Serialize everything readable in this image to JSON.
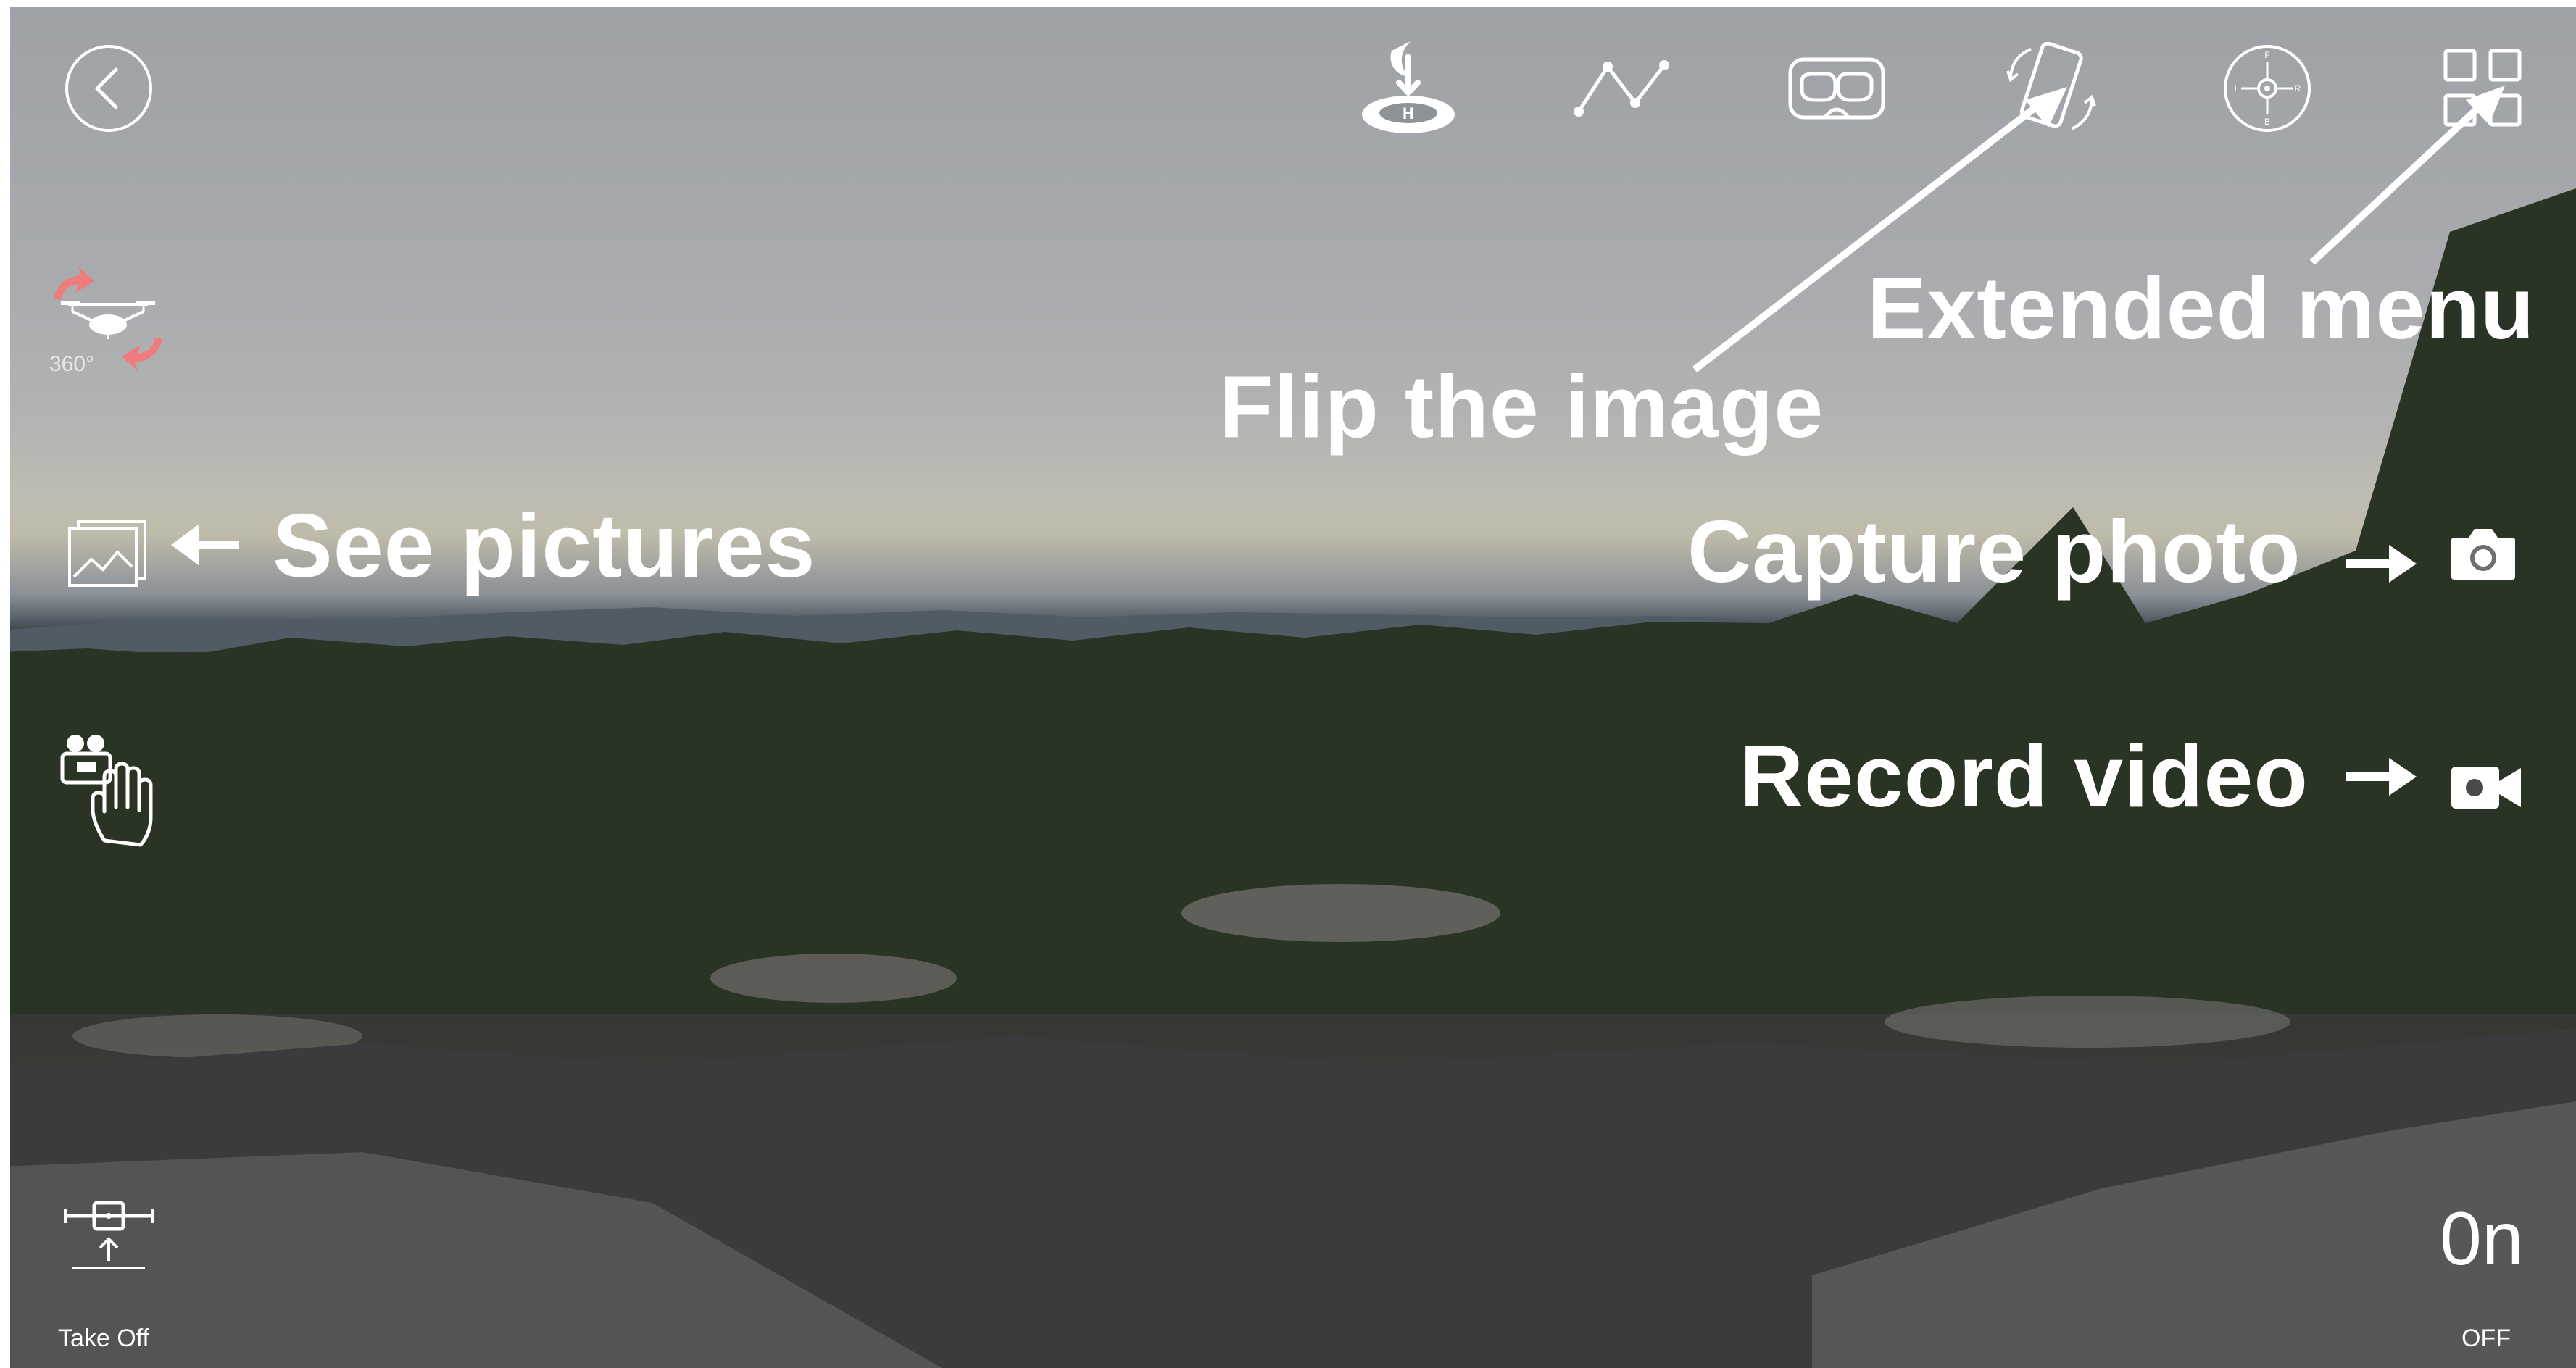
{
  "toolbar": {
    "back": {
      "icon": "back-icon"
    },
    "landing": {
      "icon": "landing-icon"
    },
    "waypoints": {
      "icon": "waypoint-path-icon"
    },
    "vr": {
      "icon": "vr-headset-icon"
    },
    "flip": {
      "icon": "flip-image-icon"
    },
    "compass": {
      "icon": "compass-icon",
      "letters": [
        "F",
        "L",
        "R",
        "B"
      ]
    },
    "extended_menu": {
      "icon": "grid-menu-icon"
    }
  },
  "left_panel": {
    "rotate": {
      "icon": "drone-rotate-icon",
      "label": "360°"
    },
    "gallery": {
      "icon": "gallery-icon"
    },
    "gesture": {
      "icon": "gesture-control-icon"
    },
    "takeoff": {
      "icon": "takeoff-icon",
      "label": "Take Off"
    }
  },
  "right_panel": {
    "capture": {
      "icon": "camera-icon"
    },
    "record": {
      "icon": "video-camera-icon"
    },
    "altitude": {
      "value": "0n",
      "state": "OFF"
    }
  },
  "annotations": {
    "see_pictures": "See pictures",
    "flip_image": "Flip the image",
    "extended_menu": "Extended menu",
    "capture_photo": "Capture photo",
    "record_video": "Record video"
  },
  "colors": {
    "accent_rotate": "#f07a7e",
    "icon": "#ffffff"
  }
}
